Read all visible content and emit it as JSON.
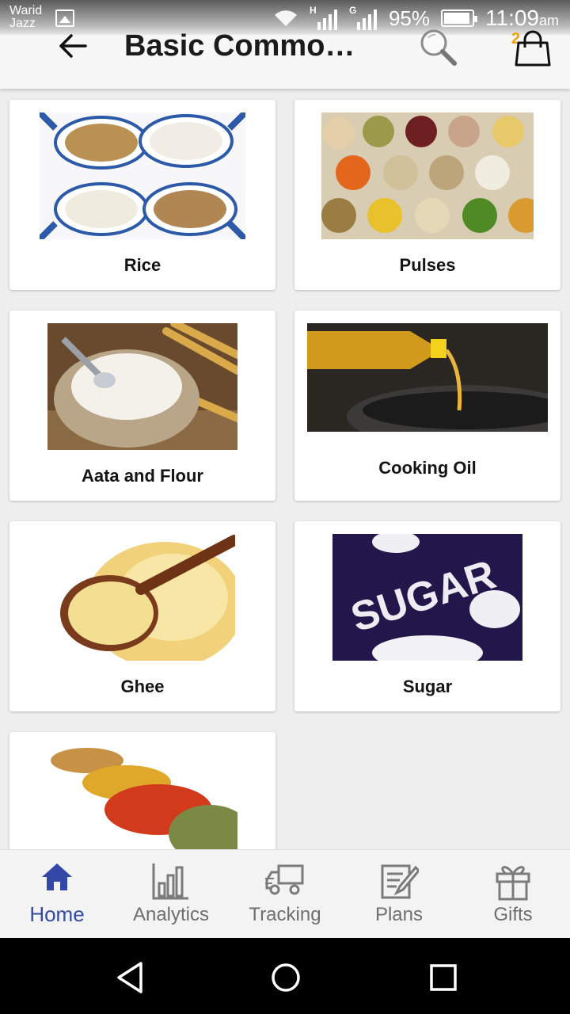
{
  "status": {
    "carrier_line1": "Warid",
    "carrier_line2": "Jazz",
    "net1": "H",
    "net2": "G",
    "battery": "95%",
    "time": "11:09",
    "ampm": "am"
  },
  "header": {
    "title": "Basic Commo…",
    "cart_count": "2"
  },
  "categories": [
    {
      "label": "Rice"
    },
    {
      "label": "Pulses"
    },
    {
      "label": "Aata and Flour"
    },
    {
      "label": "Cooking Oil"
    },
    {
      "label": "Ghee"
    },
    {
      "label": "Sugar"
    },
    {
      "label": ""
    }
  ],
  "sugar_art_text": "SUGAR",
  "bottom_nav": [
    {
      "label": "Home",
      "icon": "home-icon",
      "active": true
    },
    {
      "label": "Analytics",
      "icon": "analytics-icon",
      "active": false
    },
    {
      "label": "Tracking",
      "icon": "truck-icon",
      "active": false
    },
    {
      "label": "Plans",
      "icon": "plans-icon",
      "active": false
    },
    {
      "label": "Gifts",
      "icon": "gift-icon",
      "active": false
    }
  ],
  "colors": {
    "accent": "#3448a8",
    "badge": "#f0a000",
    "inactive": "#6e6e6e"
  }
}
